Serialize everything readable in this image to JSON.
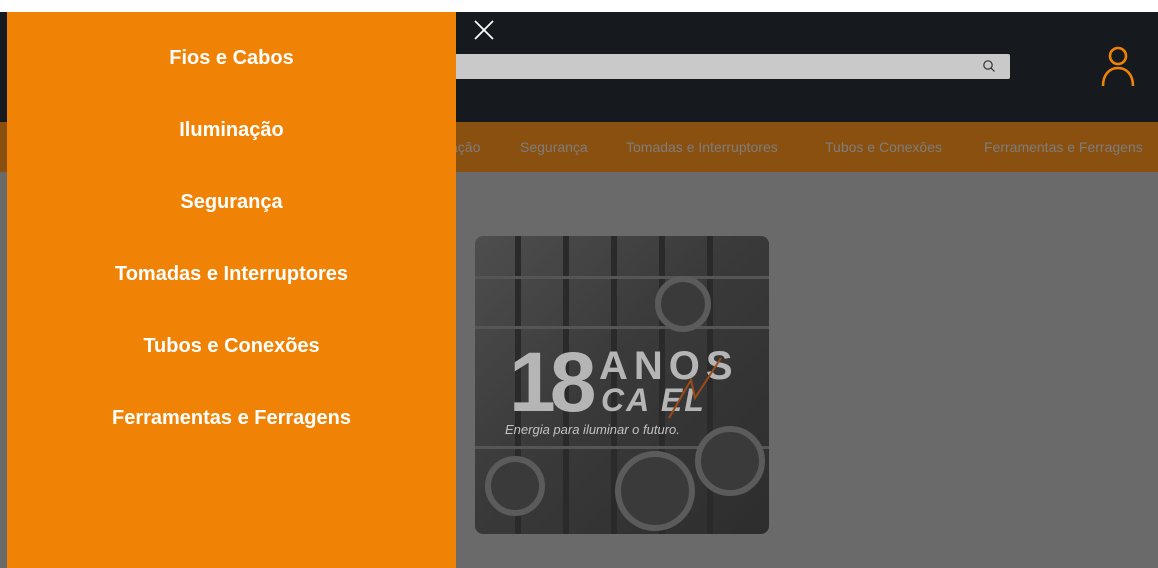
{
  "header": {
    "search": {
      "placeholder": "",
      "value": ""
    }
  },
  "category_nav": {
    "items": [
      {
        "label": "ação"
      },
      {
        "label": "Segurança"
      },
      {
        "label": "Tomadas e Interruptores"
      },
      {
        "label": "Tubos e Conexões"
      },
      {
        "label": "Ferramentas e Ferragens"
      }
    ]
  },
  "banner": {
    "years": "18",
    "anos": "ANOS",
    "brand": "CA   EL",
    "tagline": "Energia para iluminar o futuro."
  },
  "drawer": {
    "items": [
      {
        "label": "Fios e Cabos"
      },
      {
        "label": "Iluminação"
      },
      {
        "label": "Segurança"
      },
      {
        "label": "Tomadas e Interruptores"
      },
      {
        "label": "Tubos e Conexões"
      },
      {
        "label": "Ferramentas e Ferragens"
      }
    ]
  },
  "colors": {
    "drawer_bg": "#f08206",
    "header_bg": "#161a1e",
    "category_bar_bg": "#8a5010",
    "content_overlay": "#6a6a6a",
    "user_icon": "#f08206"
  },
  "icons": {
    "close": "close-icon",
    "search": "search-icon",
    "user": "user-icon"
  }
}
